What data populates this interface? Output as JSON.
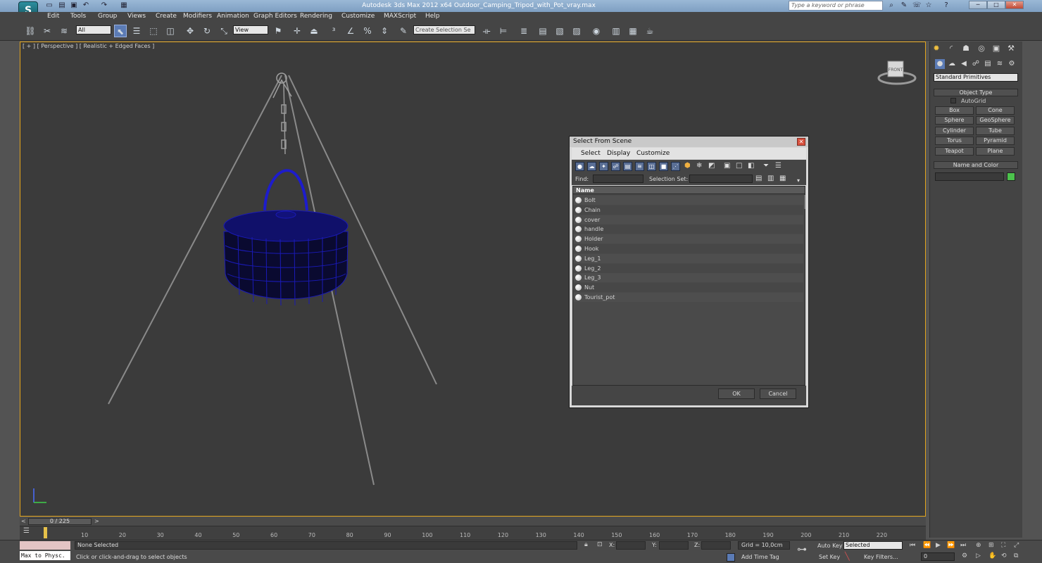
{
  "window": {
    "title": "Autodesk 3ds Max  2012 x64      Outdoor_Camping_Tripod_with_Pot_vray.max",
    "search_placeholder": "Type a keyword or phrase"
  },
  "menu": [
    "Edit",
    "Tools",
    "Group",
    "Views",
    "Create",
    "Modifiers",
    "Animation",
    "Graph Editors",
    "Rendering",
    "Customize",
    "MAXScript",
    "Help"
  ],
  "toolbar": {
    "filter_value": "All",
    "ref_coord_value": "View",
    "selection_set_placeholder": "Create Selection Se"
  },
  "viewport": {
    "label": "[ + ] [ Perspective ] [ Realistic + Edged Faces ]",
    "viewcube_label": "FRONT"
  },
  "command_panel": {
    "category_dropdown": "Standard Primitives",
    "object_type_header": "Object Type",
    "autogrid_label": "AutoGrid",
    "buttons": [
      "Box",
      "Cone",
      "Sphere",
      "GeoSphere",
      "Cylinder",
      "Tube",
      "Torus",
      "Pyramid",
      "Teapot",
      "Plane"
    ],
    "name_color_header": "Name and Color",
    "object_color": "#4cc24c"
  },
  "dialog": {
    "title": "Select From Scene",
    "menu": [
      "Select",
      "Display",
      "Customize"
    ],
    "find_label": "Find:",
    "selection_set_label": "Selection Set:",
    "column_header": "Name",
    "items": [
      "Bolt",
      "Chain",
      "cover",
      "handle",
      "Holder",
      "Hook",
      "Leg_1",
      "Leg_2",
      "Leg_3",
      "Nut",
      "Tourist_pot"
    ],
    "ok_label": "OK",
    "cancel_label": "Cancel"
  },
  "timeline": {
    "frame_display": "0 / 225",
    "ticks": [
      "10",
      "20",
      "30",
      "40",
      "50",
      "60",
      "70",
      "80",
      "90",
      "100",
      "110",
      "120",
      "130",
      "140",
      "150",
      "160",
      "170",
      "180",
      "190",
      "200",
      "210",
      "220"
    ]
  },
  "status": {
    "maxscript_listener": "Max to Physc.",
    "selection_status": "None Selected",
    "prompt": "Click or click-and-drag to select objects",
    "x_label": "X:",
    "y_label": "Y:",
    "z_label": "Z:",
    "grid": "Grid = 10,0cm",
    "add_time_tag": "Add Time Tag",
    "auto_key": "Auto Key",
    "set_key": "Set Key",
    "key_mode_value": "Selected",
    "key_filters": "Key Filters...",
    "current_frame": "0"
  }
}
